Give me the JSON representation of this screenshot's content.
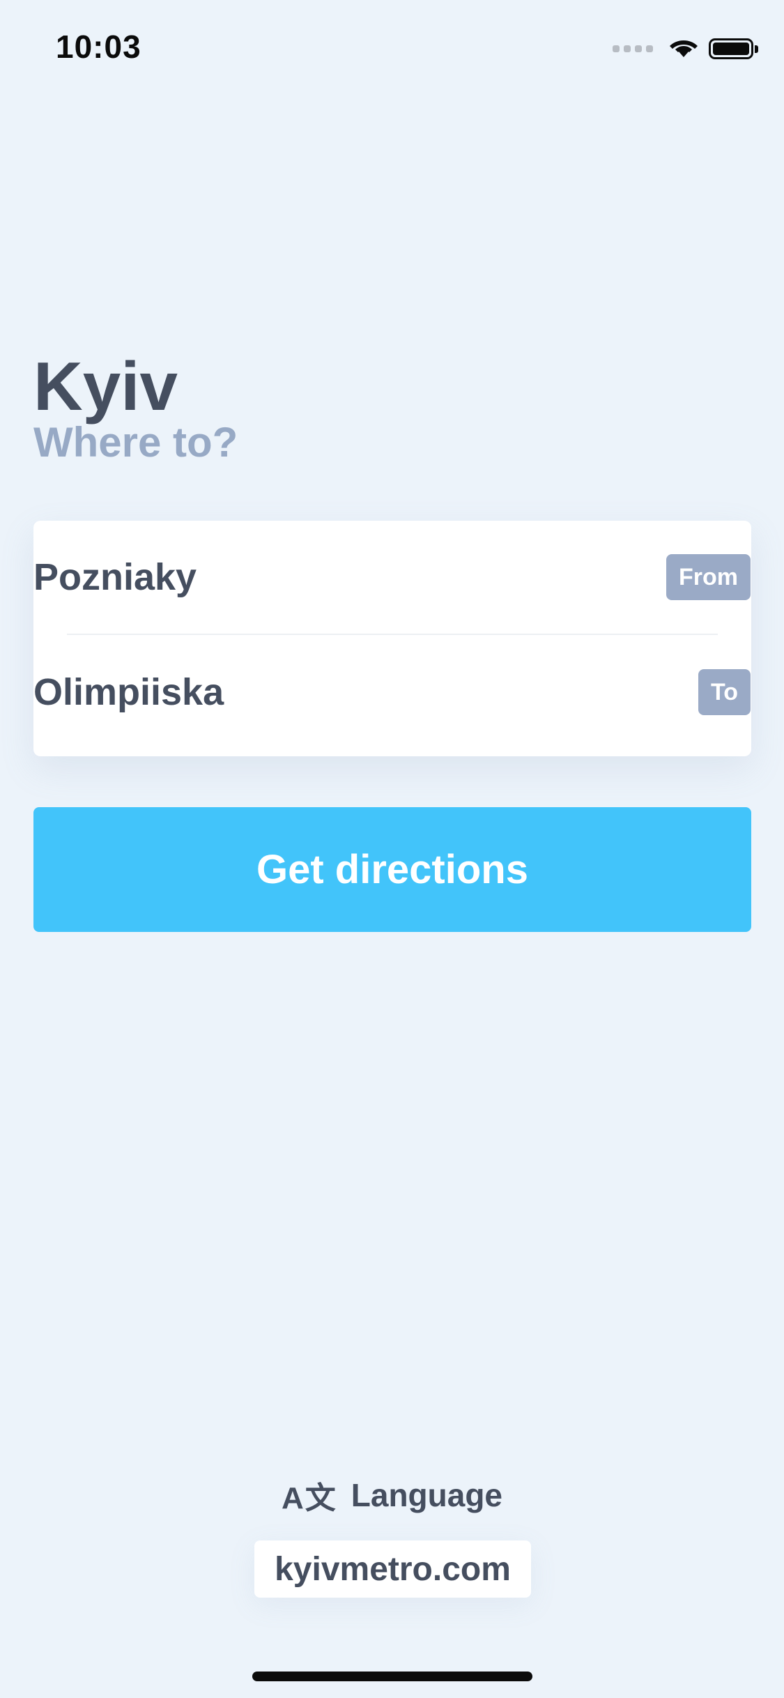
{
  "status_bar": {
    "time": "10:03",
    "icons": [
      "signal-icon",
      "wifi-icon",
      "battery-icon"
    ]
  },
  "header": {
    "city": "Kyiv",
    "subtitle": "Where to?"
  },
  "route": {
    "from": {
      "station": "Pozniaky",
      "tag": "From"
    },
    "to": {
      "station": "Olimpiiska",
      "tag": "To"
    }
  },
  "actions": {
    "get_directions": "Get directions"
  },
  "footer": {
    "language_icon": "translate-icon",
    "language_icon_glyph": "A文",
    "language_label": "Language",
    "website": "kyivmetro.com"
  },
  "colors": {
    "background": "#ECF3FA",
    "primary_text": "#454E5F",
    "secondary_text": "#97A9C5",
    "tag_background": "#9AAAC6",
    "button": "#42C4FA"
  }
}
